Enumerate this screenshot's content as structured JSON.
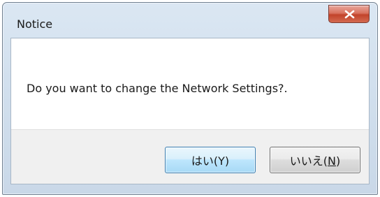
{
  "dialog": {
    "title": "Notice",
    "message": "Do you want to change the Network Settings?.",
    "yes_label": "はい(Y)",
    "no_label_prefix": "いいえ(",
    "no_label_mnemonic": "N",
    "no_label_suffix": ")",
    "close_icon": "close-x-icon"
  },
  "colors": {
    "close_button": "#c2432b",
    "default_button_border": "#3c7fb1",
    "footer_bg": "#f0f0f0"
  }
}
